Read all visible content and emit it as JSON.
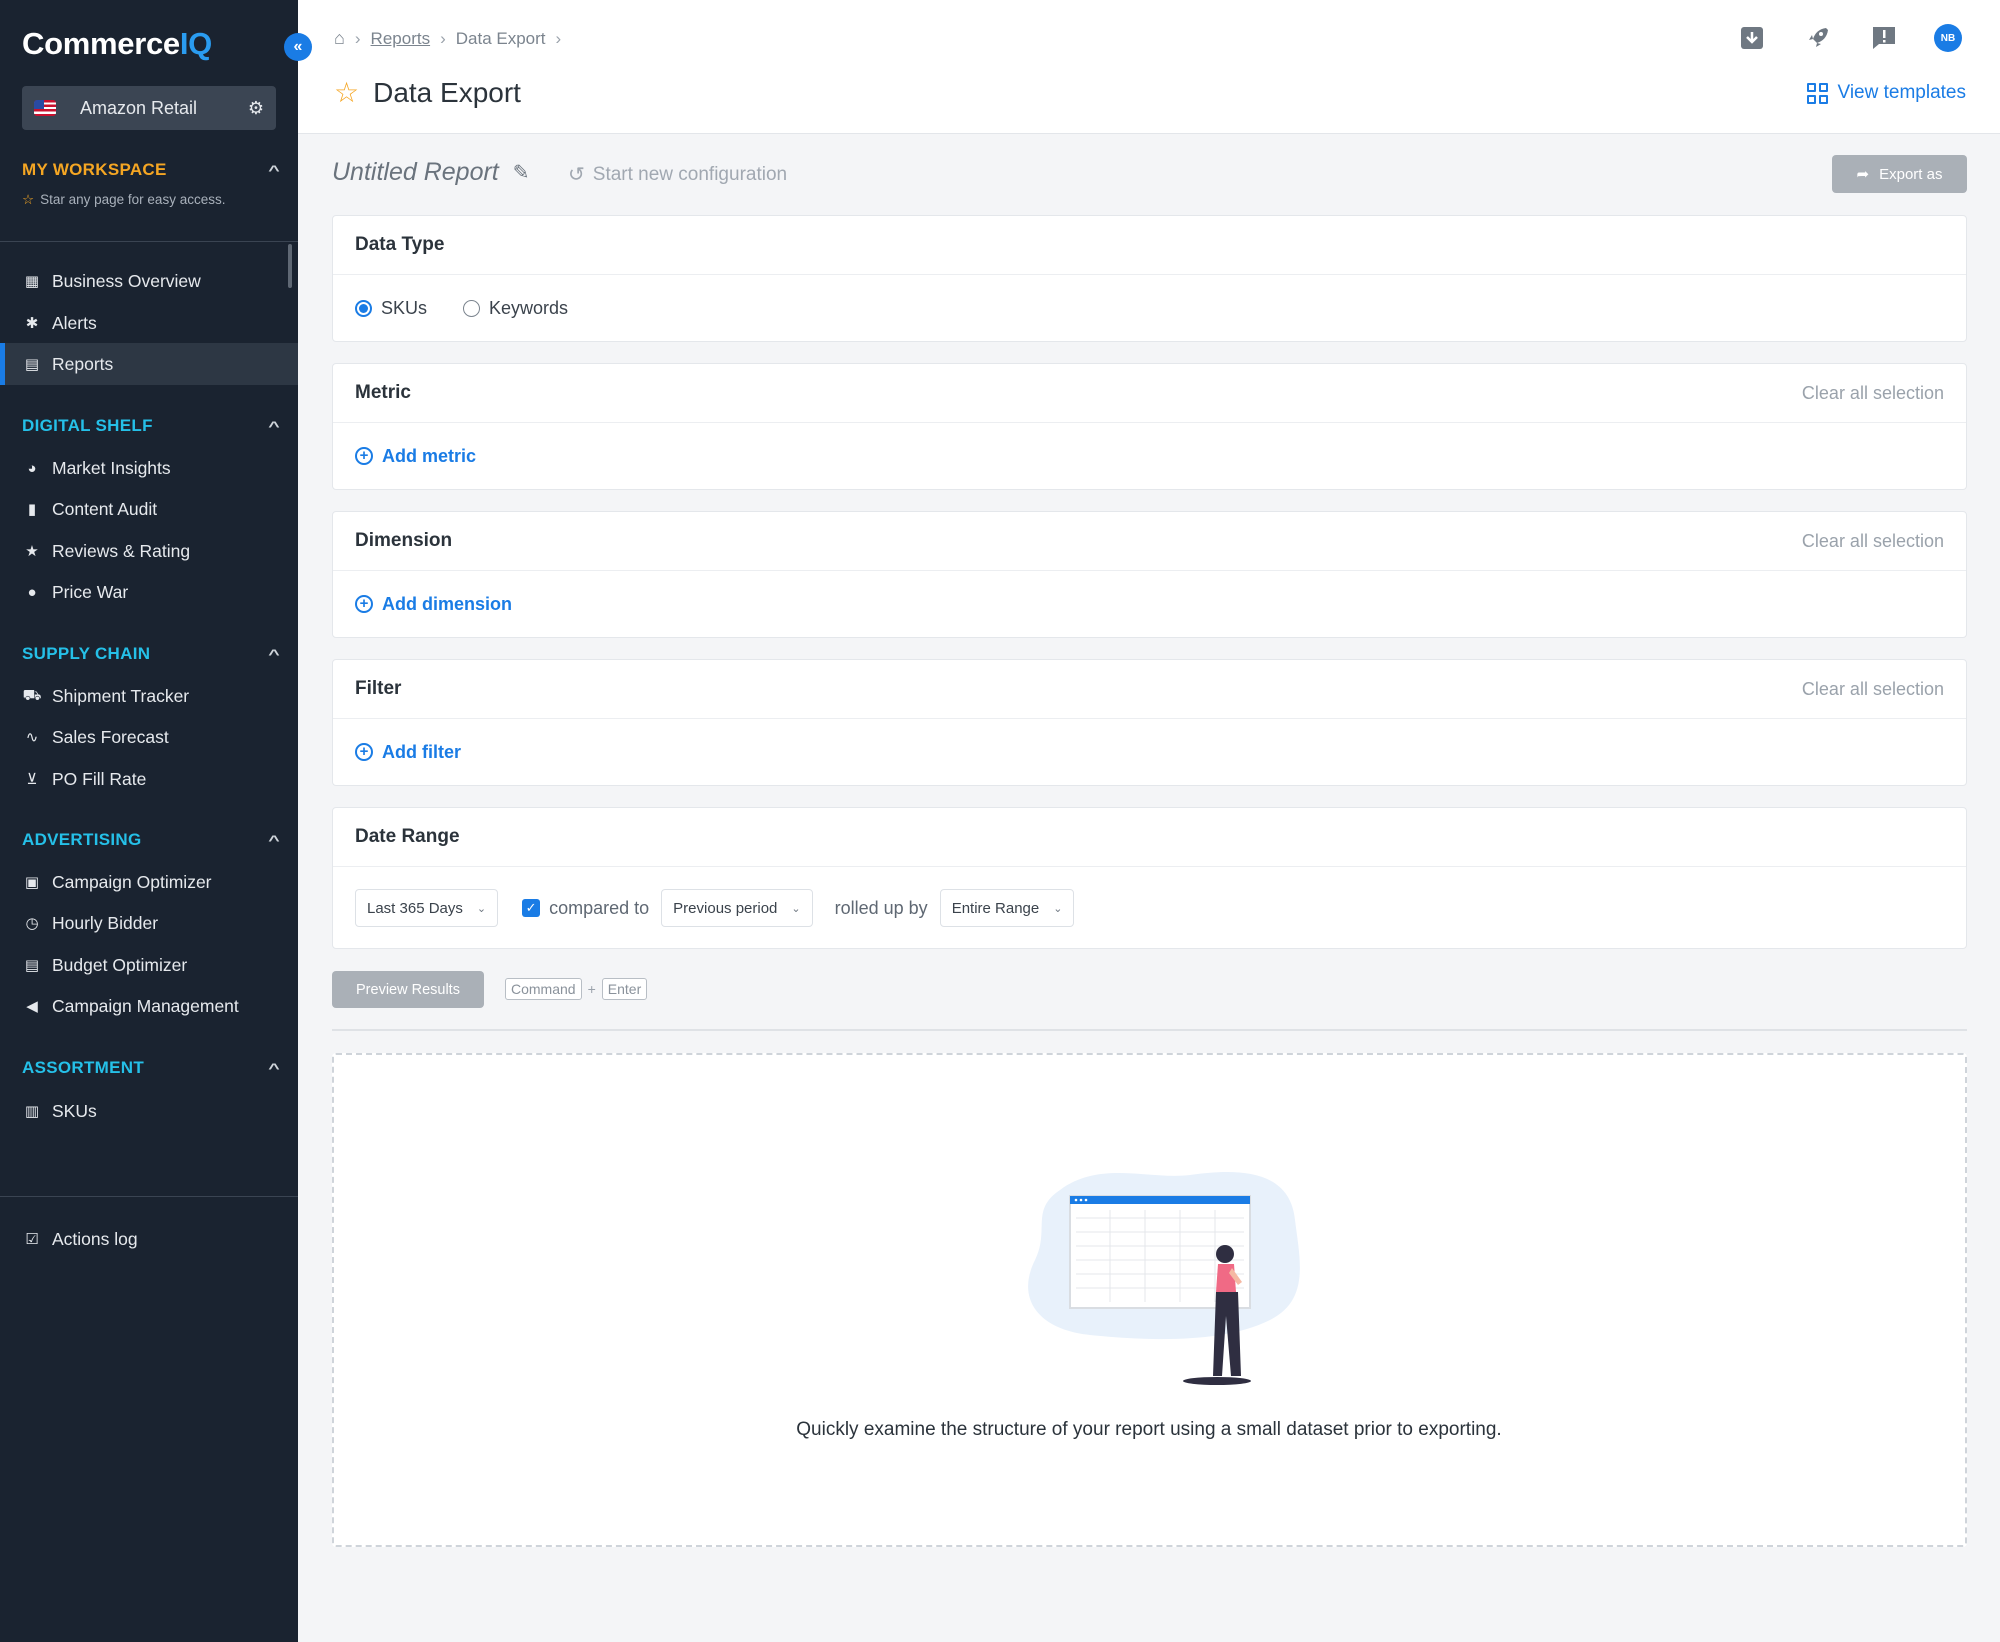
{
  "app": {
    "logo_main": "Commerce",
    "logo_accent": "IQ",
    "collapse_glyph": "«",
    "retailer": "Amazon Retail"
  },
  "sidebar": {
    "workspace": {
      "title": "MY WORKSPACE",
      "hint": "Star any page for easy access.",
      "color": "#f5a623"
    },
    "top_items": [
      {
        "label": "Business Overview",
        "icon": "store-icon"
      },
      {
        "label": "Alerts",
        "icon": "alert-bug-icon"
      },
      {
        "label": "Reports",
        "icon": "report-icon",
        "active": true
      }
    ],
    "sections": [
      {
        "title": "DIGITAL SHELF",
        "items": [
          {
            "label": "Market Insights",
            "icon": "pie-chart-icon"
          },
          {
            "label": "Content Audit",
            "icon": "document-icon"
          },
          {
            "label": "Reviews & Rating",
            "icon": "star-icon"
          },
          {
            "label": "Price War",
            "icon": "price-tag-icon"
          }
        ]
      },
      {
        "title": "SUPPLY CHAIN",
        "items": [
          {
            "label": "Shipment Tracker",
            "icon": "truck-icon"
          },
          {
            "label": "Sales Forecast",
            "icon": "wave-icon"
          },
          {
            "label": "PO Fill Rate",
            "icon": "cart-icon"
          }
        ]
      },
      {
        "title": "ADVERTISING",
        "items": [
          {
            "label": "Campaign Optimizer",
            "icon": "optimizer-icon"
          },
          {
            "label": "Hourly Bidder",
            "icon": "clock-icon"
          },
          {
            "label": "Budget Optimizer",
            "icon": "budget-icon"
          },
          {
            "label": "Campaign Management",
            "icon": "megaphone-icon"
          }
        ]
      },
      {
        "title": "ASSORTMENT",
        "items": [
          {
            "label": "SKUs",
            "icon": "barcode-icon"
          }
        ]
      }
    ],
    "section_color": "#25c0e8",
    "footer_item": {
      "label": "Actions log",
      "icon": "checklist-icon"
    }
  },
  "header": {
    "breadcrumbs": [
      "Reports",
      "Data Export"
    ],
    "title": "Data Export",
    "avatar_initials": "NB",
    "view_templates": "View templates"
  },
  "report": {
    "name": "Untitled Report",
    "restart_label": "Start new configuration",
    "export_label": "Export as"
  },
  "panels": {
    "data_type": {
      "title": "Data Type",
      "options": [
        {
          "label": "SKUs",
          "selected": true
        },
        {
          "label": "Keywords",
          "selected": false
        }
      ]
    },
    "metric": {
      "title": "Metric",
      "clear": "Clear all selection",
      "add": "Add metric"
    },
    "dimension": {
      "title": "Dimension",
      "clear": "Clear all selection",
      "add": "Add dimension"
    },
    "filter": {
      "title": "Filter",
      "clear": "Clear all selection",
      "add": "Add filter"
    },
    "date_range": {
      "title": "Date Range",
      "range": "Last 365 Days",
      "compared_checked": true,
      "compared_label": "compared to",
      "compare_period": "Previous period",
      "rolled_label": "rolled up by",
      "rollup": "Entire Range"
    }
  },
  "preview": {
    "button": "Preview Results",
    "shortcut_key1": "Command",
    "shortcut_plus": "+",
    "shortcut_key2": "Enter",
    "caption": "Quickly examine the structure of your report using a small dataset prior to exporting."
  },
  "colors": {
    "sidebar_bg": "#1a2330",
    "accent_blue": "#1a7ce5",
    "disabled_btn": "#aab0b7"
  }
}
